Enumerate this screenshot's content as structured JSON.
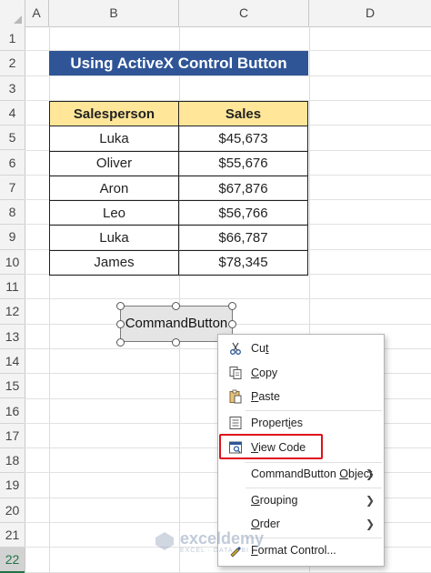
{
  "columns": [
    "A",
    "B",
    "C",
    "D"
  ],
  "rows": [
    "1",
    "2",
    "3",
    "4",
    "5",
    "6",
    "7",
    "8",
    "9",
    "10",
    "11",
    "12",
    "13",
    "14",
    "15",
    "16",
    "17",
    "18",
    "19",
    "20",
    "21",
    "22"
  ],
  "selected_row": "22",
  "title": "Using ActiveX Control Button",
  "table": {
    "headers": [
      "Salesperson",
      "Sales"
    ],
    "rows": [
      [
        "Luka",
        "$45,673"
      ],
      [
        "Oliver",
        "$55,676"
      ],
      [
        "Aron",
        "$67,876"
      ],
      [
        "Leo",
        "$56,766"
      ],
      [
        "Luka",
        "$66,787"
      ],
      [
        "James",
        "$78,345"
      ]
    ]
  },
  "command_button": {
    "label": "CommandButton"
  },
  "context_menu": {
    "cut": {
      "pre": "Cu",
      "acc": "t",
      "post": "",
      "icon": "scissors-icon"
    },
    "copy": {
      "pre": "",
      "acc": "C",
      "post": "opy",
      "icon": "copy-icon"
    },
    "paste": {
      "pre": "",
      "acc": "P",
      "post": "aste",
      "icon": "paste-icon"
    },
    "properties": {
      "pre": "Propert",
      "acc": "i",
      "post": "es",
      "icon": "properties-icon"
    },
    "view_code": {
      "pre": "",
      "acc": "V",
      "post": "iew Code",
      "icon": "view-code-icon"
    },
    "object": {
      "pre": "CommandButton ",
      "acc": "O",
      "post": "bject"
    },
    "grouping": {
      "pre": "",
      "acc": "G",
      "post": "rouping"
    },
    "order": {
      "pre": "",
      "acc": "O",
      "post": "rder"
    },
    "format_control": {
      "pre": "",
      "acc": "F",
      "post": "ormat Control...",
      "icon": "format-control-icon"
    }
  },
  "watermark": {
    "main": "exceldemy",
    "sub": "EXCEL · DATA · BI"
  },
  "colors": {
    "title_bg": "#2f5597",
    "header_bg": "#ffe699",
    "highlight": "#e0101a",
    "selected_row": "#217346"
  }
}
